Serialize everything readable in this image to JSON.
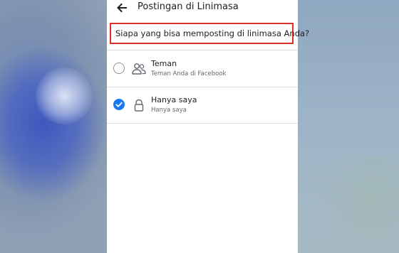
{
  "header": {
    "title": "Postingan di Linimasa",
    "back_icon": "arrow-left-icon"
  },
  "question": {
    "text": "Siapa yang bisa memposting di linimasa Anda?",
    "highlight_color": "#d9302a"
  },
  "options": [
    {
      "title": "Teman",
      "subtitle": "Teman Anda di Facebook",
      "icon": "friends-icon",
      "selected": false
    },
    {
      "title": "Hanya saya",
      "subtitle": "Hanya saya",
      "icon": "lock-icon",
      "selected": true
    }
  ],
  "colors": {
    "accent": "#1877f2",
    "text": "#1c1e21",
    "secondary_text": "#65676b"
  }
}
